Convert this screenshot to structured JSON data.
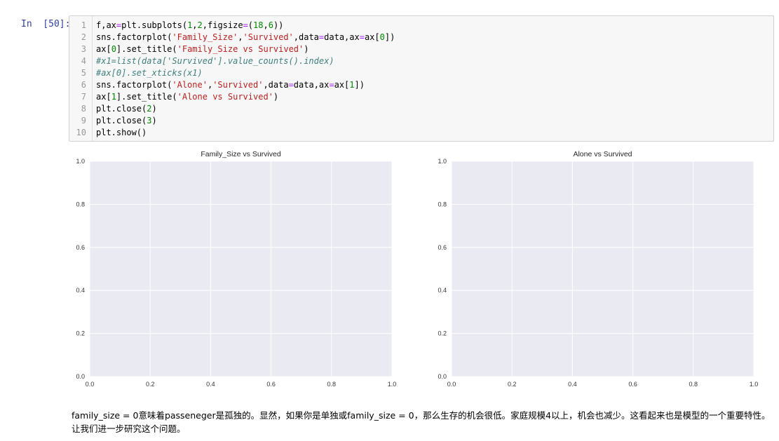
{
  "cell": {
    "prompt": "In  [50]:",
    "lines": [
      {
        "num": "1",
        "tokens": [
          {
            "t": "f,ax"
          },
          {
            "t": "=",
            "c": "tok-op"
          },
          {
            "t": "plt.subplots("
          },
          {
            "t": "1",
            "c": "tok-num"
          },
          {
            "t": ","
          },
          {
            "t": "2",
            "c": "tok-num"
          },
          {
            "t": ",figsize"
          },
          {
            "t": "=",
            "c": "tok-op"
          },
          {
            "t": "("
          },
          {
            "t": "18",
            "c": "tok-num"
          },
          {
            "t": ","
          },
          {
            "t": "6",
            "c": "tok-num"
          },
          {
            "t": "))"
          }
        ]
      },
      {
        "num": "2",
        "tokens": [
          {
            "t": "sns.factorplot("
          },
          {
            "t": "'Family_Size'",
            "c": "tok-str"
          },
          {
            "t": ","
          },
          {
            "t": "'Survived'",
            "c": "tok-str"
          },
          {
            "t": ",data"
          },
          {
            "t": "=",
            "c": "tok-op"
          },
          {
            "t": "data,ax"
          },
          {
            "t": "=",
            "c": "tok-op"
          },
          {
            "t": "ax["
          },
          {
            "t": "0",
            "c": "tok-num"
          },
          {
            "t": "])"
          }
        ]
      },
      {
        "num": "3",
        "tokens": [
          {
            "t": "ax["
          },
          {
            "t": "0",
            "c": "tok-num"
          },
          {
            "t": "].set_title("
          },
          {
            "t": "'Family_Size vs Survived'",
            "c": "tok-str"
          },
          {
            "t": ")"
          }
        ]
      },
      {
        "num": "4",
        "tokens": [
          {
            "t": "#x1=list(data['Survived'].value_counts().index)",
            "c": "tok-com"
          }
        ]
      },
      {
        "num": "5",
        "tokens": [
          {
            "t": "#ax[0].set_xticks(x1)",
            "c": "tok-com"
          }
        ]
      },
      {
        "num": "6",
        "tokens": [
          {
            "t": "sns.factorplot("
          },
          {
            "t": "'Alone'",
            "c": "tok-str"
          },
          {
            "t": ","
          },
          {
            "t": "'Survived'",
            "c": "tok-str"
          },
          {
            "t": ",data"
          },
          {
            "t": "=",
            "c": "tok-op"
          },
          {
            "t": "data,ax"
          },
          {
            "t": "=",
            "c": "tok-op"
          },
          {
            "t": "ax["
          },
          {
            "t": "1",
            "c": "tok-num"
          },
          {
            "t": "])"
          }
        ]
      },
      {
        "num": "7",
        "tokens": [
          {
            "t": "ax["
          },
          {
            "t": "1",
            "c": "tok-num"
          },
          {
            "t": "].set_title("
          },
          {
            "t": "'Alone vs Survived'",
            "c": "tok-str"
          },
          {
            "t": ")"
          }
        ]
      },
      {
        "num": "8",
        "tokens": [
          {
            "t": "plt.close("
          },
          {
            "t": "2",
            "c": "tok-num"
          },
          {
            "t": ")"
          }
        ]
      },
      {
        "num": "9",
        "tokens": [
          {
            "t": "plt.close("
          },
          {
            "t": "3",
            "c": "tok-num"
          },
          {
            "t": ")"
          }
        ]
      },
      {
        "num": "10",
        "tokens": [
          {
            "t": "plt.show()"
          }
        ]
      }
    ]
  },
  "colors": {
    "axes_bg": "#eaeaf2",
    "grid": "#ffffff",
    "tick_text": "#333333",
    "prompt": "#303f9f"
  },
  "chart_data": [
    {
      "type": "line",
      "title": "Family_Size vs Survived",
      "xlabel": "",
      "ylabel": "",
      "xlim": [
        0,
        1
      ],
      "ylim": [
        0,
        1
      ],
      "xticks": [
        "0.0",
        "0.2",
        "0.4",
        "0.6",
        "0.8",
        "1.0"
      ],
      "yticks": [
        "0.0",
        "0.2",
        "0.4",
        "0.6",
        "0.8",
        "1.0"
      ],
      "series": [],
      "grid": true
    },
    {
      "type": "line",
      "title": "Alone vs Survived",
      "xlabel": "",
      "ylabel": "",
      "xlim": [
        0,
        1
      ],
      "ylim": [
        0,
        1
      ],
      "xticks": [
        "0.0",
        "0.2",
        "0.4",
        "0.6",
        "0.8",
        "1.0"
      ],
      "yticks": [
        "0.0",
        "0.2",
        "0.4",
        "0.6",
        "0.8",
        "1.0"
      ],
      "series": [],
      "grid": true
    }
  ],
  "markdown": {
    "text": "family_size = 0意味着passeneger是孤独的。显然，如果你是单独或family_size = 0，那么生存的机会很低。家庭规模4以上，机会也减少。这看起来也是模型的一个重要特性。让我们进一步研究这个问题。"
  }
}
